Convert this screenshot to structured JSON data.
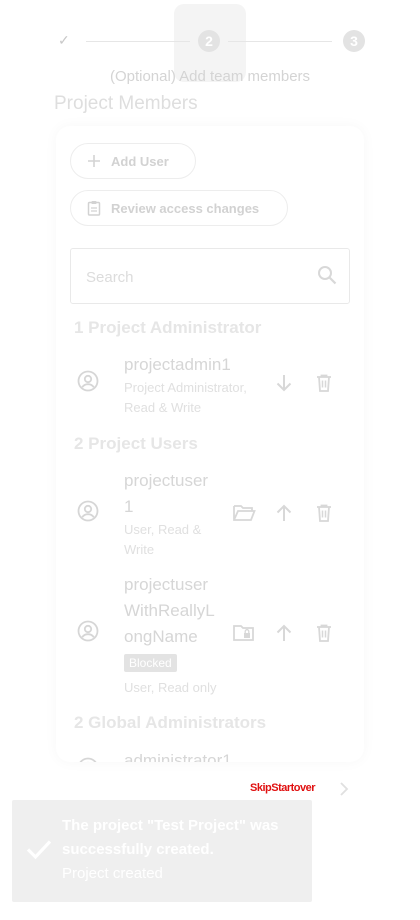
{
  "stepper": {
    "done_mark": "✓",
    "step2_number": "2",
    "step3_number": "3",
    "active_label": "(Optional) Add team members"
  },
  "page_title": "Project Members",
  "actions": {
    "add_user_label": "Add User",
    "review_label": "Review access changes"
  },
  "search": {
    "placeholder": "Search"
  },
  "groups": {
    "admins": {
      "heading": "1 Project Administrator",
      "members": [
        {
          "name": "projectadmin1",
          "role_line1": "Project Administrator,",
          "role_line2": "Read & Write"
        }
      ]
    },
    "users": {
      "heading": "2 Project Users",
      "members": [
        {
          "name_line1": "projectuser",
          "name_line2": "1",
          "role_line1": "User, Read &",
          "role_line2": "Write"
        },
        {
          "name_line1": "projectuser",
          "name_line2": "WithReallyL",
          "name_line3": "ongName",
          "badge": "Blocked",
          "role": "User, Read only"
        }
      ]
    },
    "global": {
      "heading": "2 Global Administrators",
      "members": [
        {
          "name": "administrator1"
        }
      ]
    }
  },
  "bottom": {
    "back_label": "SkipStartover"
  },
  "snackbar": {
    "title": "The project \"Test Project\" was successfully created.",
    "subtitle": "Project created"
  },
  "colors": {
    "muted_icon": "#d9d9d9",
    "error_red": "#e01010",
    "snackbar_bg": "#efefef"
  },
  "icons": {
    "add": "plus-icon",
    "review": "clipboard-icon",
    "search": "search-icon",
    "avatar": "account-circle-icon",
    "demote": "arrow-down-icon",
    "promote": "arrow-up-icon",
    "delete": "trash-icon",
    "folder": "folder-open-icon",
    "folder_blocked": "folder-lock-icon",
    "next": "chevron-right-icon",
    "success": "check-icon"
  }
}
